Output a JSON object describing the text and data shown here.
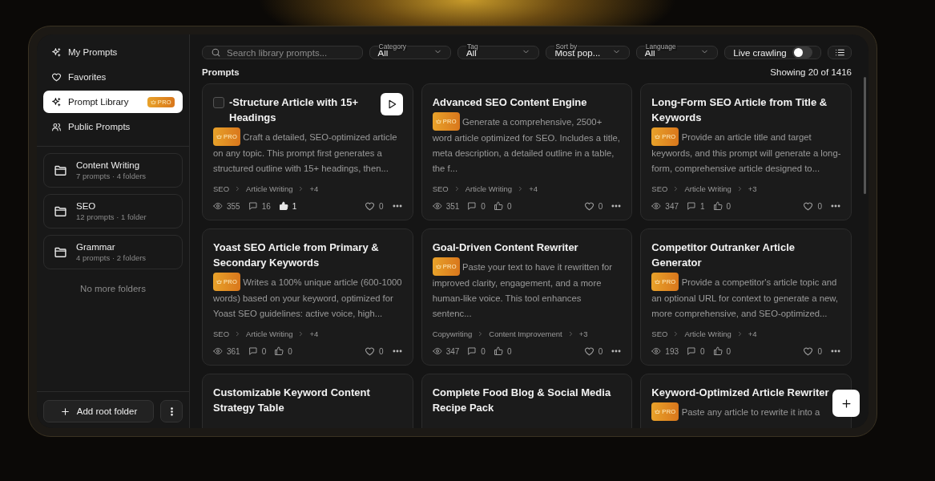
{
  "sidebar": {
    "nav": [
      {
        "label": "My Prompts",
        "selected": false
      },
      {
        "label": "Favorites",
        "selected": false
      },
      {
        "label": "Prompt Library",
        "selected": true,
        "badge": "PRO"
      },
      {
        "label": "Public Prompts",
        "selected": false
      }
    ],
    "folders": [
      {
        "name": "Content Writing",
        "meta": "7 prompts · 4 folders"
      },
      {
        "name": "SEO",
        "meta": "12 prompts · 1 folder"
      },
      {
        "name": "Grammar",
        "meta": "4 prompts · 2 folders"
      }
    ],
    "empty_note": "No more folders",
    "add_button": "Add root folder"
  },
  "toolbar": {
    "search": {
      "placeholder": "Search library prompts..."
    },
    "filters": [
      {
        "label": "Category",
        "value": "All"
      },
      {
        "label": "Tag",
        "value": "All"
      },
      {
        "label": "Sort by",
        "value": "Most pop..."
      },
      {
        "label": "Language",
        "value": "All"
      }
    ],
    "live_crawling": {
      "label": "Live crawling",
      "on": false
    }
  },
  "section_title": "Prompts",
  "count": "Showing 20 of 1416",
  "cards": [
    {
      "title": "-Structure Article with 15+ Headings",
      "badge": "PRO",
      "description": "Craft a detailed, SEO-optimized article on any topic. This prompt first generates a structured outline with 15+ headings, then...",
      "tags": [
        "SEO",
        "Article Writing",
        "+4"
      ],
      "views": "355",
      "comments": "16",
      "likes": "1",
      "liked": true,
      "hearts": "0",
      "hovered": true,
      "checked": false
    },
    {
      "title": "Advanced SEO Content Engine",
      "badge": "PRO",
      "description": "Generate a comprehensive, 2500+ word article optimized for SEO. Includes a title, meta description, a detailed outline in a table, the f...",
      "tags": [
        "SEO",
        "Article Writing",
        "+4"
      ],
      "views": "351",
      "comments": "0",
      "likes": "0",
      "liked": false,
      "hearts": "0",
      "hovered": false
    },
    {
      "title": "Long-Form SEO Article from Title & Keywords",
      "badge": "PRO",
      "description": "Provide an article title and target keywords, and this prompt will generate a long-form, comprehensive article designed to...",
      "tags": [
        "SEO",
        "Article Writing",
        "+3"
      ],
      "views": "347",
      "comments": "1",
      "likes": "0",
      "liked": false,
      "hearts": "0",
      "hovered": false
    },
    {
      "title": "Yoast SEO Article from Primary & Secondary Keywords",
      "badge": "PRO",
      "description": "Writes a 100% unique article (600-1000 words) based on your keyword, optimized for Yoast SEO guidelines: active voice, high...",
      "tags": [
        "SEO",
        "Article Writing",
        "+4"
      ],
      "views": "361",
      "comments": "0",
      "likes": "0",
      "liked": false,
      "hearts": "0",
      "hovered": false
    },
    {
      "title": "Goal-Driven Content Rewriter",
      "badge": "PRO",
      "description": "Paste your text to have it rewritten for improved clarity, engagement, and a more human-like voice. This tool enhances sentenc...",
      "tags": [
        "Copywriting",
        "Content Improvement",
        "+3"
      ],
      "views": "347",
      "comments": "0",
      "likes": "0",
      "liked": false,
      "hearts": "0",
      "hovered": false
    },
    {
      "title": "Competitor Outranker Article Generator",
      "badge": "PRO",
      "description": "Provide a competitor's article topic and an optional URL for context to generate a new, more comprehensive, and SEO-optimized...",
      "tags": [
        "SEO",
        "Article Writing",
        "+4"
      ],
      "views": "193",
      "comments": "0",
      "likes": "0",
      "liked": false,
      "hearts": "0",
      "hovered": false
    },
    {
      "title": "Customizable Keyword Content Strategy Table",
      "hovered": false
    },
    {
      "title": "Complete Food Blog & Social Media Recipe Pack",
      "hovered": false
    },
    {
      "title": "Keyword-Optimized Article Rewriter",
      "badge": "PRO",
      "description": "Paste any article to rewrite it into a",
      "hovered": false
    }
  ]
}
